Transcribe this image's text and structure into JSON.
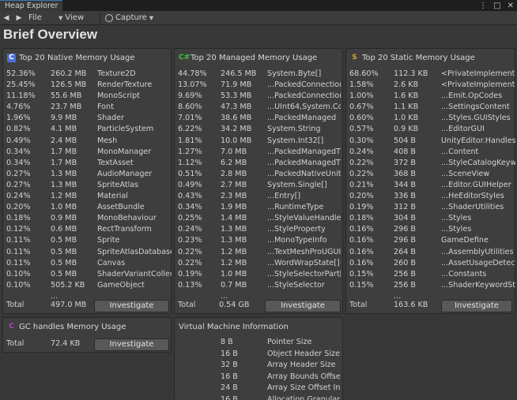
{
  "window": {
    "tab_title": "Heap Explorer"
  },
  "toolbar": {
    "back": "◀",
    "forward": "▶",
    "file": "File",
    "view": "View",
    "capture": "Capture"
  },
  "page_title": "Brief Overview",
  "colors": {
    "native_icon": "#4a6fd8",
    "managed_icon": "#3cc63c",
    "static_icon": "#e0a020",
    "gc_icon": "#c040c8"
  },
  "native": {
    "title": "Top 20 Native Memory Usage",
    "rows": [
      {
        "pct": "52.36%",
        "size": "260.2 MB",
        "name": "Texture2D"
      },
      {
        "pct": "25.45%",
        "size": "126.5 MB",
        "name": "RenderTexture"
      },
      {
        "pct": "11.18%",
        "size": "55.6 MB",
        "name": "MonoScript"
      },
      {
        "pct": "4.76%",
        "size": "23.7 MB",
        "name": "Font"
      },
      {
        "pct": "1.96%",
        "size": "9.9 MB",
        "name": "Shader"
      },
      {
        "pct": "0.82%",
        "size": "4.1 MB",
        "name": "ParticleSystem"
      },
      {
        "pct": "0.49%",
        "size": "2.4 MB",
        "name": "Mesh"
      },
      {
        "pct": "0.34%",
        "size": "1.7 MB",
        "name": "MonoManager"
      },
      {
        "pct": "0.34%",
        "size": "1.7 MB",
        "name": "TextAsset"
      },
      {
        "pct": "0.27%",
        "size": "1.3 MB",
        "name": "AudioManager"
      },
      {
        "pct": "0.27%",
        "size": "1.3 MB",
        "name": "SpriteAtlas"
      },
      {
        "pct": "0.24%",
        "size": "1.2 MB",
        "name": "Material"
      },
      {
        "pct": "0.20%",
        "size": "1.0 MB",
        "name": "AssetBundle"
      },
      {
        "pct": "0.18%",
        "size": "0.9 MB",
        "name": "MonoBehaviour"
      },
      {
        "pct": "0.12%",
        "size": "0.6 MB",
        "name": "RectTransform"
      },
      {
        "pct": "0.11%",
        "size": "0.5 MB",
        "name": "Sprite"
      },
      {
        "pct": "0.11%",
        "size": "0.5 MB",
        "name": "SpriteAtlasDatabase"
      },
      {
        "pct": "0.11%",
        "size": "0.5 MB",
        "name": "Canvas"
      },
      {
        "pct": "0.10%",
        "size": "0.5 MB",
        "name": "ShaderVariantCollection"
      },
      {
        "pct": "0.10%",
        "size": "505.2 KB",
        "name": "GameObject"
      }
    ],
    "ellipsis": "...",
    "total_label": "Total",
    "total_value": "497.0 MB",
    "button": "Investigate"
  },
  "managed": {
    "title": "Top 20 Managed Memory Usage",
    "rows": [
      {
        "pct": "44.78%",
        "size": "246.5 MB",
        "name": "System.Byte[]"
      },
      {
        "pct": "13.07%",
        "size": "71.9 MB",
        "name": "...PackedConnection"
      },
      {
        "pct": "9.69%",
        "size": "53.3 MB",
        "name": "...PackedConnection"
      },
      {
        "pct": "8.60%",
        "size": "47.3 MB",
        "name": "...UInt64,System.Co"
      },
      {
        "pct": "7.01%",
        "size": "38.6 MB",
        "name": "...PackedManaged"
      },
      {
        "pct": "6.22%",
        "size": "34.2 MB",
        "name": "System.String"
      },
      {
        "pct": "1.81%",
        "size": "10.0 MB",
        "name": "System.Int32[]"
      },
      {
        "pct": "1.27%",
        "size": "7.0 MB",
        "name": "...PackedManagedT"
      },
      {
        "pct": "1.12%",
        "size": "6.2 MB",
        "name": "...PackedManagedT"
      },
      {
        "pct": "0.51%",
        "size": "2.8 MB",
        "name": "...PackedNativeUnit"
      },
      {
        "pct": "0.49%",
        "size": "2.7 MB",
        "name": "System.Single[]"
      },
      {
        "pct": "0.43%",
        "size": "2.3 MB",
        "name": "...Entry[]"
      },
      {
        "pct": "0.34%",
        "size": "1.9 MB",
        "name": "...RuntimeType"
      },
      {
        "pct": "0.25%",
        "size": "1.4 MB",
        "name": "...StyleValueHandle"
      },
      {
        "pct": "0.24%",
        "size": "1.3 MB",
        "name": "...StyleProperty"
      },
      {
        "pct": "0.23%",
        "size": "1.3 MB",
        "name": "...MonoTypeInfo"
      },
      {
        "pct": "0.22%",
        "size": "1.2 MB",
        "name": "...TextMeshProUGUI"
      },
      {
        "pct": "0.22%",
        "size": "1.2 MB",
        "name": "...WordWrapState[]"
      },
      {
        "pct": "0.19%",
        "size": "1.0 MB",
        "name": "...StyleSelectorPart[]"
      },
      {
        "pct": "0.13%",
        "size": "0.7 MB",
        "name": "...StyleSelector"
      }
    ],
    "ellipsis": "...",
    "total_label": "Total",
    "total_value": "0.54 GB",
    "button": "Investigate"
  },
  "static": {
    "title": "Top 20 Static Memory Usage",
    "rows": [
      {
        "pct": "68.60%",
        "size": "112.3 KB",
        "name": "<PrivateImplementa"
      },
      {
        "pct": "1.58%",
        "size": "2.6 KB",
        "name": "<PrivateImplementa"
      },
      {
        "pct": "1.00%",
        "size": "1.6 KB",
        "name": "...Emit.OpCodes"
      },
      {
        "pct": "0.67%",
        "size": "1.1 KB",
        "name": "...SettingsContent"
      },
      {
        "pct": "0.60%",
        "size": "1.0 KB",
        "name": "...Styles.GUIStyles"
      },
      {
        "pct": "0.57%",
        "size": "0.9 KB",
        "name": "...EditorGUI"
      },
      {
        "pct": "0.30%",
        "size": "504 B",
        "name": "UnityEditor.Handles"
      },
      {
        "pct": "0.24%",
        "size": "408 B",
        "name": "...Content"
      },
      {
        "pct": "0.22%",
        "size": "372 B",
        "name": "...StyleCatalogKeyw"
      },
      {
        "pct": "0.22%",
        "size": "368 B",
        "name": "...SceneView"
      },
      {
        "pct": "0.21%",
        "size": "344 B",
        "name": "...Editor.GUIHelper"
      },
      {
        "pct": "0.20%",
        "size": "336 B",
        "name": "...HeEditorStyles"
      },
      {
        "pct": "0.19%",
        "size": "312 B",
        "name": "...ShaderUtilities"
      },
      {
        "pct": "0.18%",
        "size": "304 B",
        "name": "...Styles"
      },
      {
        "pct": "0.16%",
        "size": "296 B",
        "name": "...Styles"
      },
      {
        "pct": "0.16%",
        "size": "296 B",
        "name": "GameDefine"
      },
      {
        "pct": "0.16%",
        "size": "264 B",
        "name": "...AssemblyUtilities"
      },
      {
        "pct": "0.16%",
        "size": "260 B",
        "name": "...AssetUsageDetect"
      },
      {
        "pct": "0.15%",
        "size": "256 B",
        "name": "...Constants"
      },
      {
        "pct": "0.15%",
        "size": "256 B",
        "name": "...ShaderKeywordSt"
      }
    ],
    "ellipsis": "...",
    "total_label": "Total",
    "total_value": "163.6 KB",
    "button": "Investigate"
  },
  "gc": {
    "title": "GC handles Memory Usage",
    "total_label": "Total",
    "total_value": "72.4 KB",
    "button": "Investigate"
  },
  "vm": {
    "title": "Virtual Machine Information",
    "rows": [
      {
        "value": "8 B",
        "label": "Pointer Size"
      },
      {
        "value": "16 B",
        "label": "Object Header Size"
      },
      {
        "value": "32 B",
        "label": "Array Header Size"
      },
      {
        "value": "16 B",
        "label": "Array Bounds Offset In Header"
      },
      {
        "value": "24 B",
        "label": "Array Size Offset In Header"
      },
      {
        "value": "16 B",
        "label": "Allocation Granularity"
      }
    ]
  }
}
